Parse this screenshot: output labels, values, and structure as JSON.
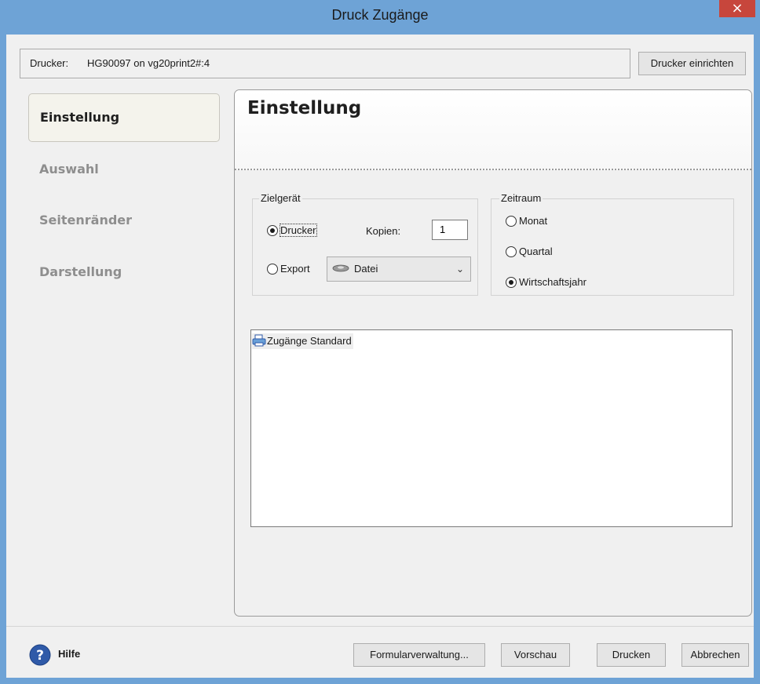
{
  "window": {
    "title": "Druck Zugänge",
    "close_symbol": "×"
  },
  "printer": {
    "label": "Drucker:",
    "name": "HG90097 on vg20print2#:4",
    "setup_button": "Drucker einrichten"
  },
  "sidebar": {
    "items": [
      {
        "label": "Einstellung",
        "active": true
      },
      {
        "label": "Auswahl",
        "active": false
      },
      {
        "label": "Seitenränder",
        "active": false
      },
      {
        "label": "Darstellung",
        "active": false
      }
    ]
  },
  "panel": {
    "title": "Einstellung",
    "zielgeraet": {
      "legend": "Zielgerät",
      "drucker_label": "Drucker",
      "drucker_selected": true,
      "kopien_label": "Kopien:",
      "kopien_value": "1",
      "export_label": "Export",
      "export_selected": false,
      "export_format": "Datei",
      "export_format_icon": "disk-icon"
    },
    "zeitraum": {
      "legend": "Zeitraum",
      "options": [
        {
          "label": "Monat",
          "selected": false
        },
        {
          "label": "Quartal",
          "selected": false
        },
        {
          "label": "Wirtschaftsjahr",
          "selected": true
        }
      ]
    },
    "forms_list": {
      "items": [
        {
          "label": "Zugänge Standard",
          "icon": "printer-icon"
        }
      ]
    }
  },
  "footer": {
    "help_label": "Hilfe",
    "formularverwaltung_button": "Formularverwaltung...",
    "vorschau_button": "Vorschau",
    "drucken_button": "Drucken",
    "abbrechen_button": "Abbrechen"
  },
  "colors": {
    "titlebar": "#6ea3d6",
    "close": "#c7463c",
    "help_icon": "#2f5aa8"
  }
}
